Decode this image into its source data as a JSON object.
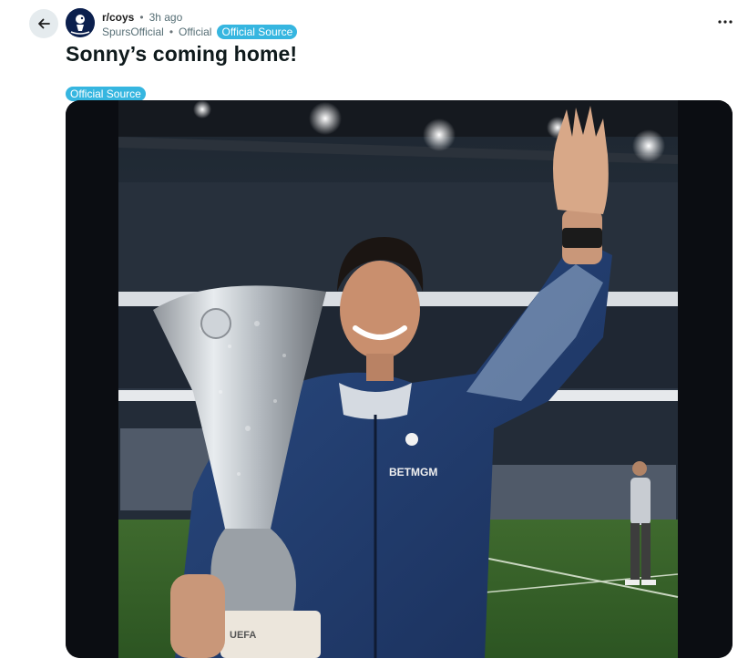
{
  "post": {
    "subreddit": "r/coys",
    "time_ago": "3h ago",
    "author": "SpursOfficial",
    "separator": "•",
    "author_flair_text": "Official",
    "author_flair_badge": "Official Source",
    "title": "Sonny’s coming home!",
    "post_flair": "Official Source",
    "image": {
      "sponsor_text": "BETMGM",
      "trophy_text": "UEFA"
    }
  },
  "colors": {
    "flair_bg": "#36b6e0",
    "back_button_bg": "#e5ebee"
  },
  "icons": {
    "back": "arrow-left-icon",
    "more": "more-horizontal-icon"
  }
}
